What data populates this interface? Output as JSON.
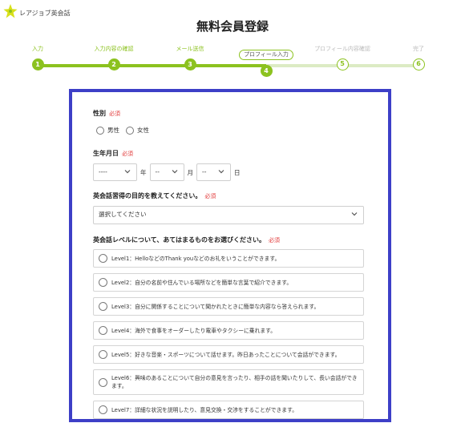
{
  "logo": {
    "text": "レアジョブ英会話"
  },
  "page_title": "無料会員登録",
  "colors": {
    "accent": "#8cc21f",
    "frame": "#3d3fc7",
    "required": "#e23b3b"
  },
  "steps": [
    {
      "label": "入力",
      "number": "1",
      "state": "done"
    },
    {
      "label": "入力内容の確認",
      "number": "2",
      "state": "done"
    },
    {
      "label": "メール送信",
      "number": "3",
      "state": "done"
    },
    {
      "label": "プロフィール入力",
      "number": "4",
      "state": "current"
    },
    {
      "label": "プロフィール内容確認",
      "number": "5",
      "state": "todo"
    },
    {
      "label": "完了",
      "number": "6",
      "state": "todo"
    }
  ],
  "form": {
    "required_label": "必須",
    "gender": {
      "label": "性別",
      "options": [
        "男性",
        "女性"
      ]
    },
    "birthdate": {
      "label": "生年月日",
      "year_value": "----",
      "year_unit": "年",
      "month_value": "--",
      "month_unit": "月",
      "day_value": "--",
      "day_unit": "日"
    },
    "purpose": {
      "label": "英会話習得の目的を教えてください。",
      "value": "選択してください"
    },
    "level": {
      "label": "英会話レベルについて、あてはまるものをお選びください。",
      "options": [
        "Level1：HelloなどのThank youなどのお礼をいうことができます。",
        "Level2：自分の名前や住んでいる場所などを簡単な言葉で紹介できます。",
        "Level3：自分に関係することについて聞かれたときに簡単な内容なら答えられます。",
        "Level4：海外で食事をオーダーしたり電車やタクシーに乗れます。",
        "Level5：好きな音楽・スポーツについて話せます。昨日あったことについて会話ができます。",
        "Level6：興味のあることについて自分の意見を言ったり、相手の話を聞いたりして、長い会話ができます。",
        "Level7：詳細な状況を説明したり、意見交換・交渉をすることができます。"
      ]
    }
  }
}
